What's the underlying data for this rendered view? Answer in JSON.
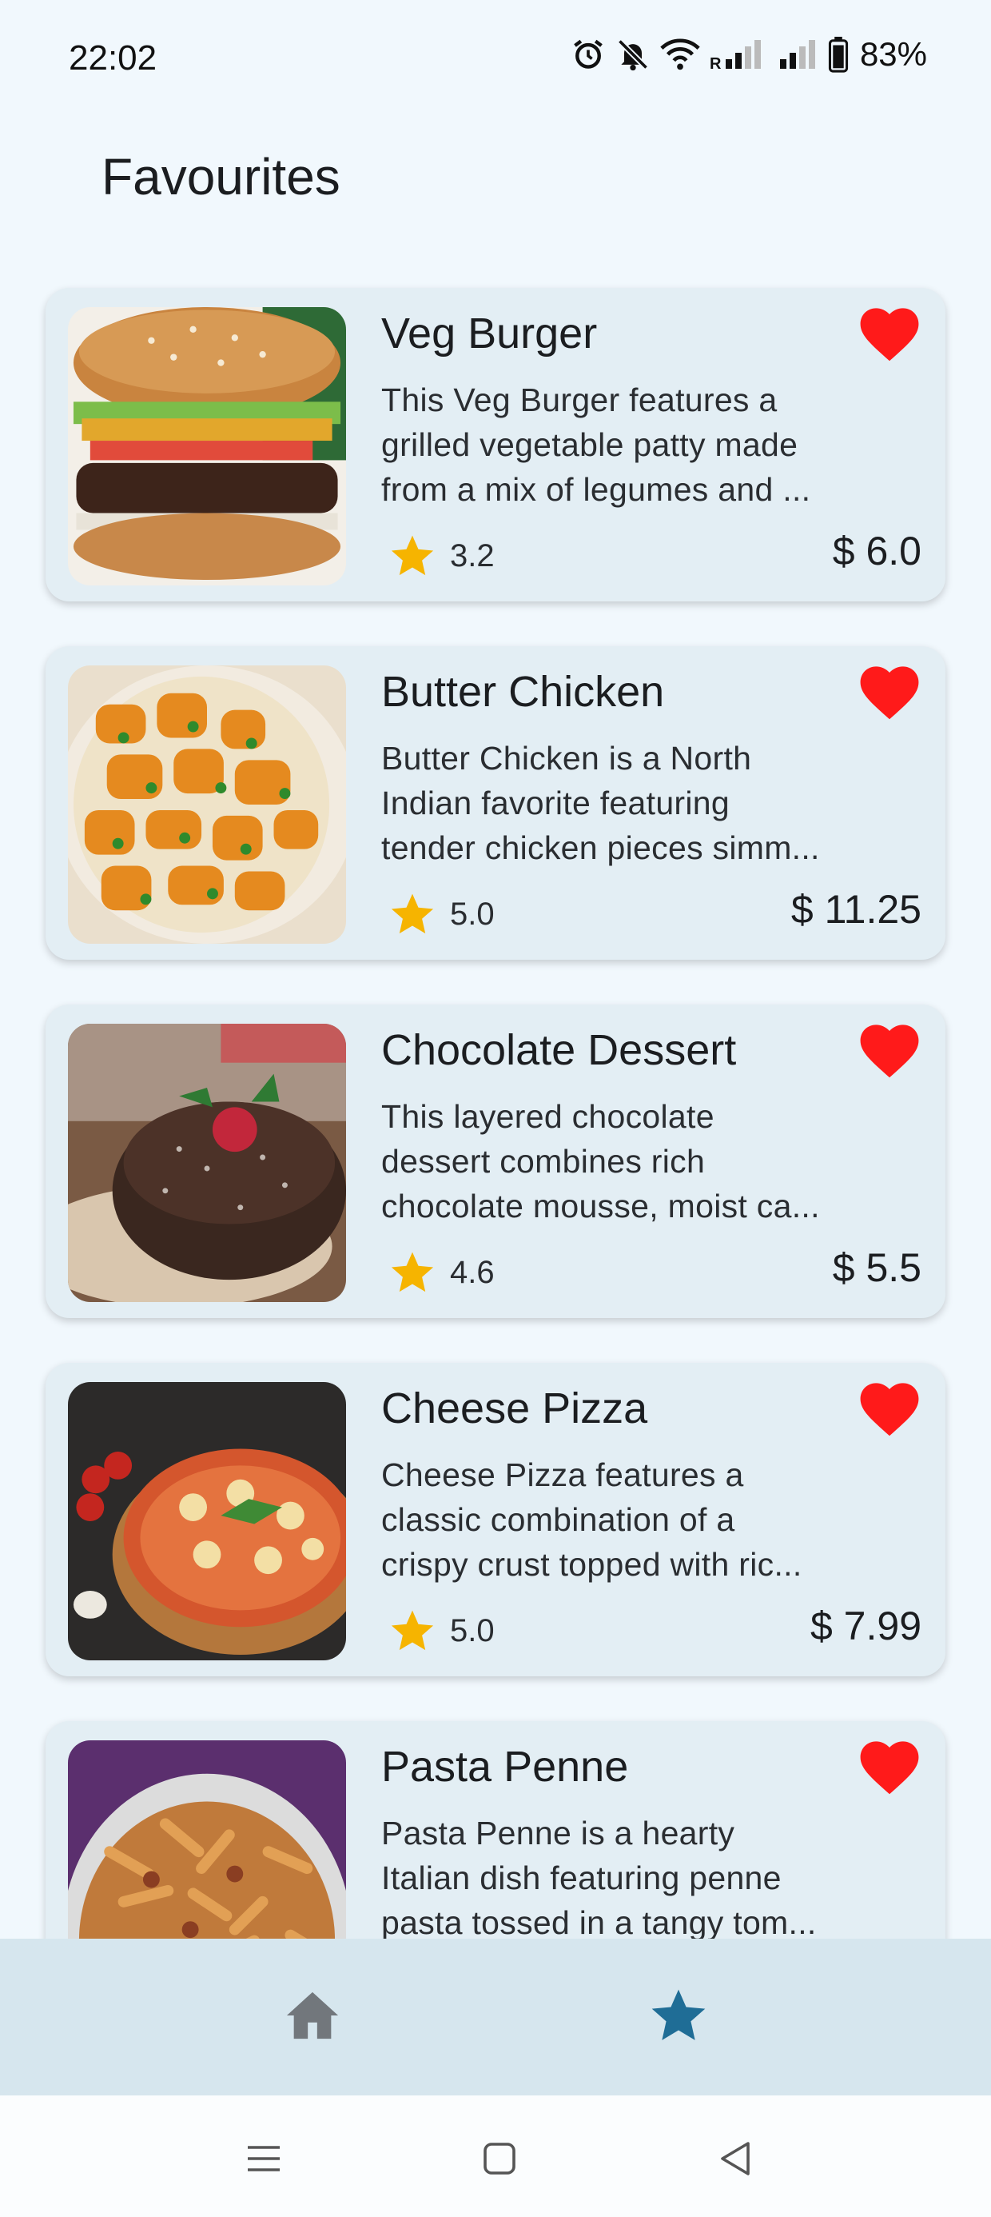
{
  "status_bar": {
    "time": "22:02",
    "battery": "83%",
    "icons": [
      "alarm-icon",
      "bell-off-icon",
      "wifi-icon",
      "signal-icon",
      "signal-icon",
      "battery-icon"
    ]
  },
  "page": {
    "title": "Favourites"
  },
  "items": [
    {
      "name": "Veg Burger",
      "desc_lines": [
        "This Veg Burger features a",
        "grilled vegetable patty made",
        "from a mix of legumes and ..."
      ],
      "rating": "3.2",
      "price": "$ 6.0",
      "image": "burger"
    },
    {
      "name": "Butter Chicken",
      "desc_lines": [
        "Butter Chicken is a North",
        "Indian favorite featuring",
        "tender chicken pieces simm..."
      ],
      "rating": "5.0",
      "price": "$ 11.25",
      "image": "butter-chicken"
    },
    {
      "name": "Chocolate Dessert",
      "desc_lines": [
        "This layered chocolate",
        "dessert combines rich",
        "chocolate mousse, moist ca..."
      ],
      "rating": "4.6",
      "price": "$ 5.5",
      "image": "chocolate-cake"
    },
    {
      "name": "Cheese Pizza",
      "desc_lines": [
        "Cheese Pizza features a",
        "classic combination of a",
        "crispy crust topped with ric..."
      ],
      "rating": "5.0",
      "price": "$ 7.99",
      "image": "pizza"
    },
    {
      "name": "Pasta Penne",
      "desc_lines": [
        "Pasta Penne is a hearty",
        "Italian dish featuring penne",
        "pasta tossed in a tangy tom..."
      ],
      "rating": "",
      "price": "",
      "image": "pasta"
    }
  ],
  "bottom_nav": {
    "items": [
      {
        "icon": "home-icon",
        "active": false
      },
      {
        "icon": "star-icon",
        "active": true
      }
    ]
  },
  "system_nav": {
    "icons": [
      "menu-icon",
      "square-icon",
      "back-triangle-icon"
    ]
  },
  "colors": {
    "background": "#f1f8fd",
    "card": "#e3eef4",
    "heart": "#ff1a1a",
    "star": "#f6b400",
    "nav_active": "#1f6d96",
    "nav_inactive": "#72777c",
    "bottom_nav_bg": "#d6e6ee"
  }
}
